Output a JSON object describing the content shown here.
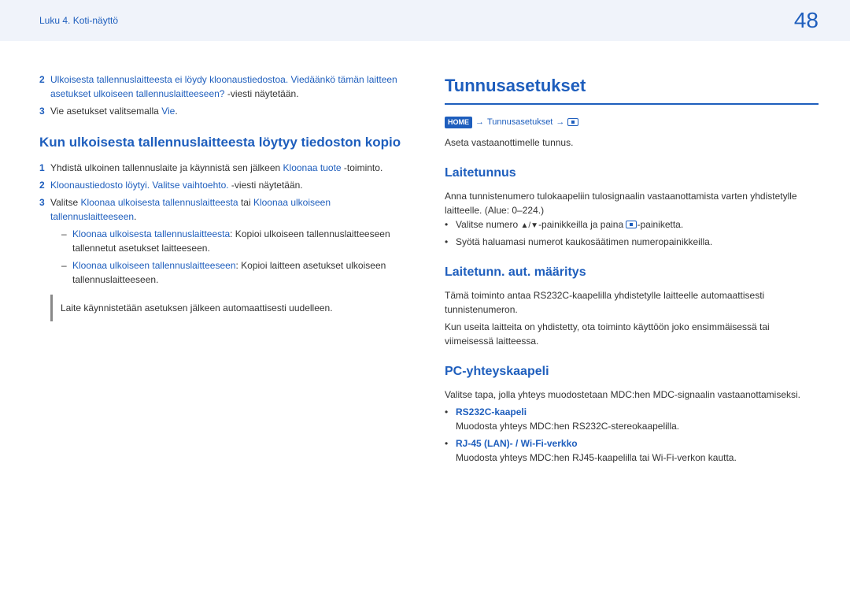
{
  "header": {
    "chapter": "Luku 4. Koti-näyttö",
    "page_number": "48"
  },
  "left": {
    "items": {
      "2": {
        "msg_a": "Ulkoisesta tallennuslaitteesta ei löydy kloonaustiedostoa. Viedäänkö tämän laitteen asetukset ulkoiseen tallennuslaitteeseen?",
        "msg_b": " -viesti näytetään."
      },
      "3": {
        "pre": "Vie asetukset valitsemalla ",
        "link": "Vie",
        "post": "."
      }
    },
    "h2": "Kun ulkoisesta tallennuslaitteesta löytyy tiedoston kopio",
    "copy_items": {
      "1": {
        "pre": "Yhdistä ulkoinen tallennuslaite ja käynnistä sen jälkeen ",
        "link": "Kloonaa tuote",
        "post": " -toiminto."
      },
      "2": {
        "link": "Kloonaustiedosto löytyi. Valitse vaihtoehto.",
        "post": " -viesti näytetään."
      },
      "3": {
        "pre": "Valitse ",
        "link1": "Kloonaa ulkoisesta tallennuslaitteesta",
        "mid": " tai ",
        "link2": "Kloonaa ulkoiseen tallennuslaitteeseen",
        "post": "."
      },
      "sub1": {
        "label": "Kloonaa ulkoisesta tallennuslaitteesta",
        "desc": ": Kopioi ulkoiseen tallennuslaitteeseen tallennetut asetukset laitteeseen."
      },
      "sub2": {
        "label": "Kloonaa ulkoiseen tallennuslaitteeseen",
        "desc": ": Kopioi laitteen asetukset ulkoiseen tallennuslaitteeseen."
      }
    },
    "note": "Laite käynnistetään asetuksen jälkeen automaattisesti uudelleen."
  },
  "right": {
    "h1": "Tunnusasetukset",
    "nav": {
      "home": "HOME",
      "arrow": "→",
      "link": "Tunnusasetukset"
    },
    "intro": "Aseta vastaanottimelle tunnus.",
    "laitetunnus": {
      "title": "Laitetunnus",
      "desc": "Anna tunnistenumero tulokaapeliin tulosignaalin vastaanottamista varten yhdistetylle laitteelle. (Alue: 0–224.)",
      "b1_pre": "Valitse numero ",
      "b1_arrows": "▲/▼",
      "b1_mid": "-painikkeilla ja paina ",
      "b1_post": "-painiketta.",
      "b2": "Syötä haluamasi numerot kaukosäätimen numeropainikkeilla."
    },
    "auto": {
      "title": "Laitetunn. aut. määritys",
      "p1": "Tämä toiminto antaa RS232C-kaapelilla yhdistetylle laitteelle automaattisesti tunnistenumeron.",
      "p2": "Kun useita laitteita on yhdistetty, ota toiminto käyttöön joko ensimmäisessä tai viimeisessä laitteessa."
    },
    "pc": {
      "title": "PC-yhteyskaapeli",
      "desc": "Valitse tapa, jolla yhteys muodostetaan MDC:hen MDC-signaalin vastaanottamiseksi.",
      "b1_label": "RS232C-kaapeli",
      "b1_desc": "Muodosta yhteys MDC:hen RS232C-stereokaapelilla.",
      "b2_label": "RJ-45 (LAN)- / Wi-Fi-verkko",
      "b2_desc": "Muodosta yhteys MDC:hen RJ45-kaapelilla tai Wi-Fi-verkon kautta."
    }
  }
}
